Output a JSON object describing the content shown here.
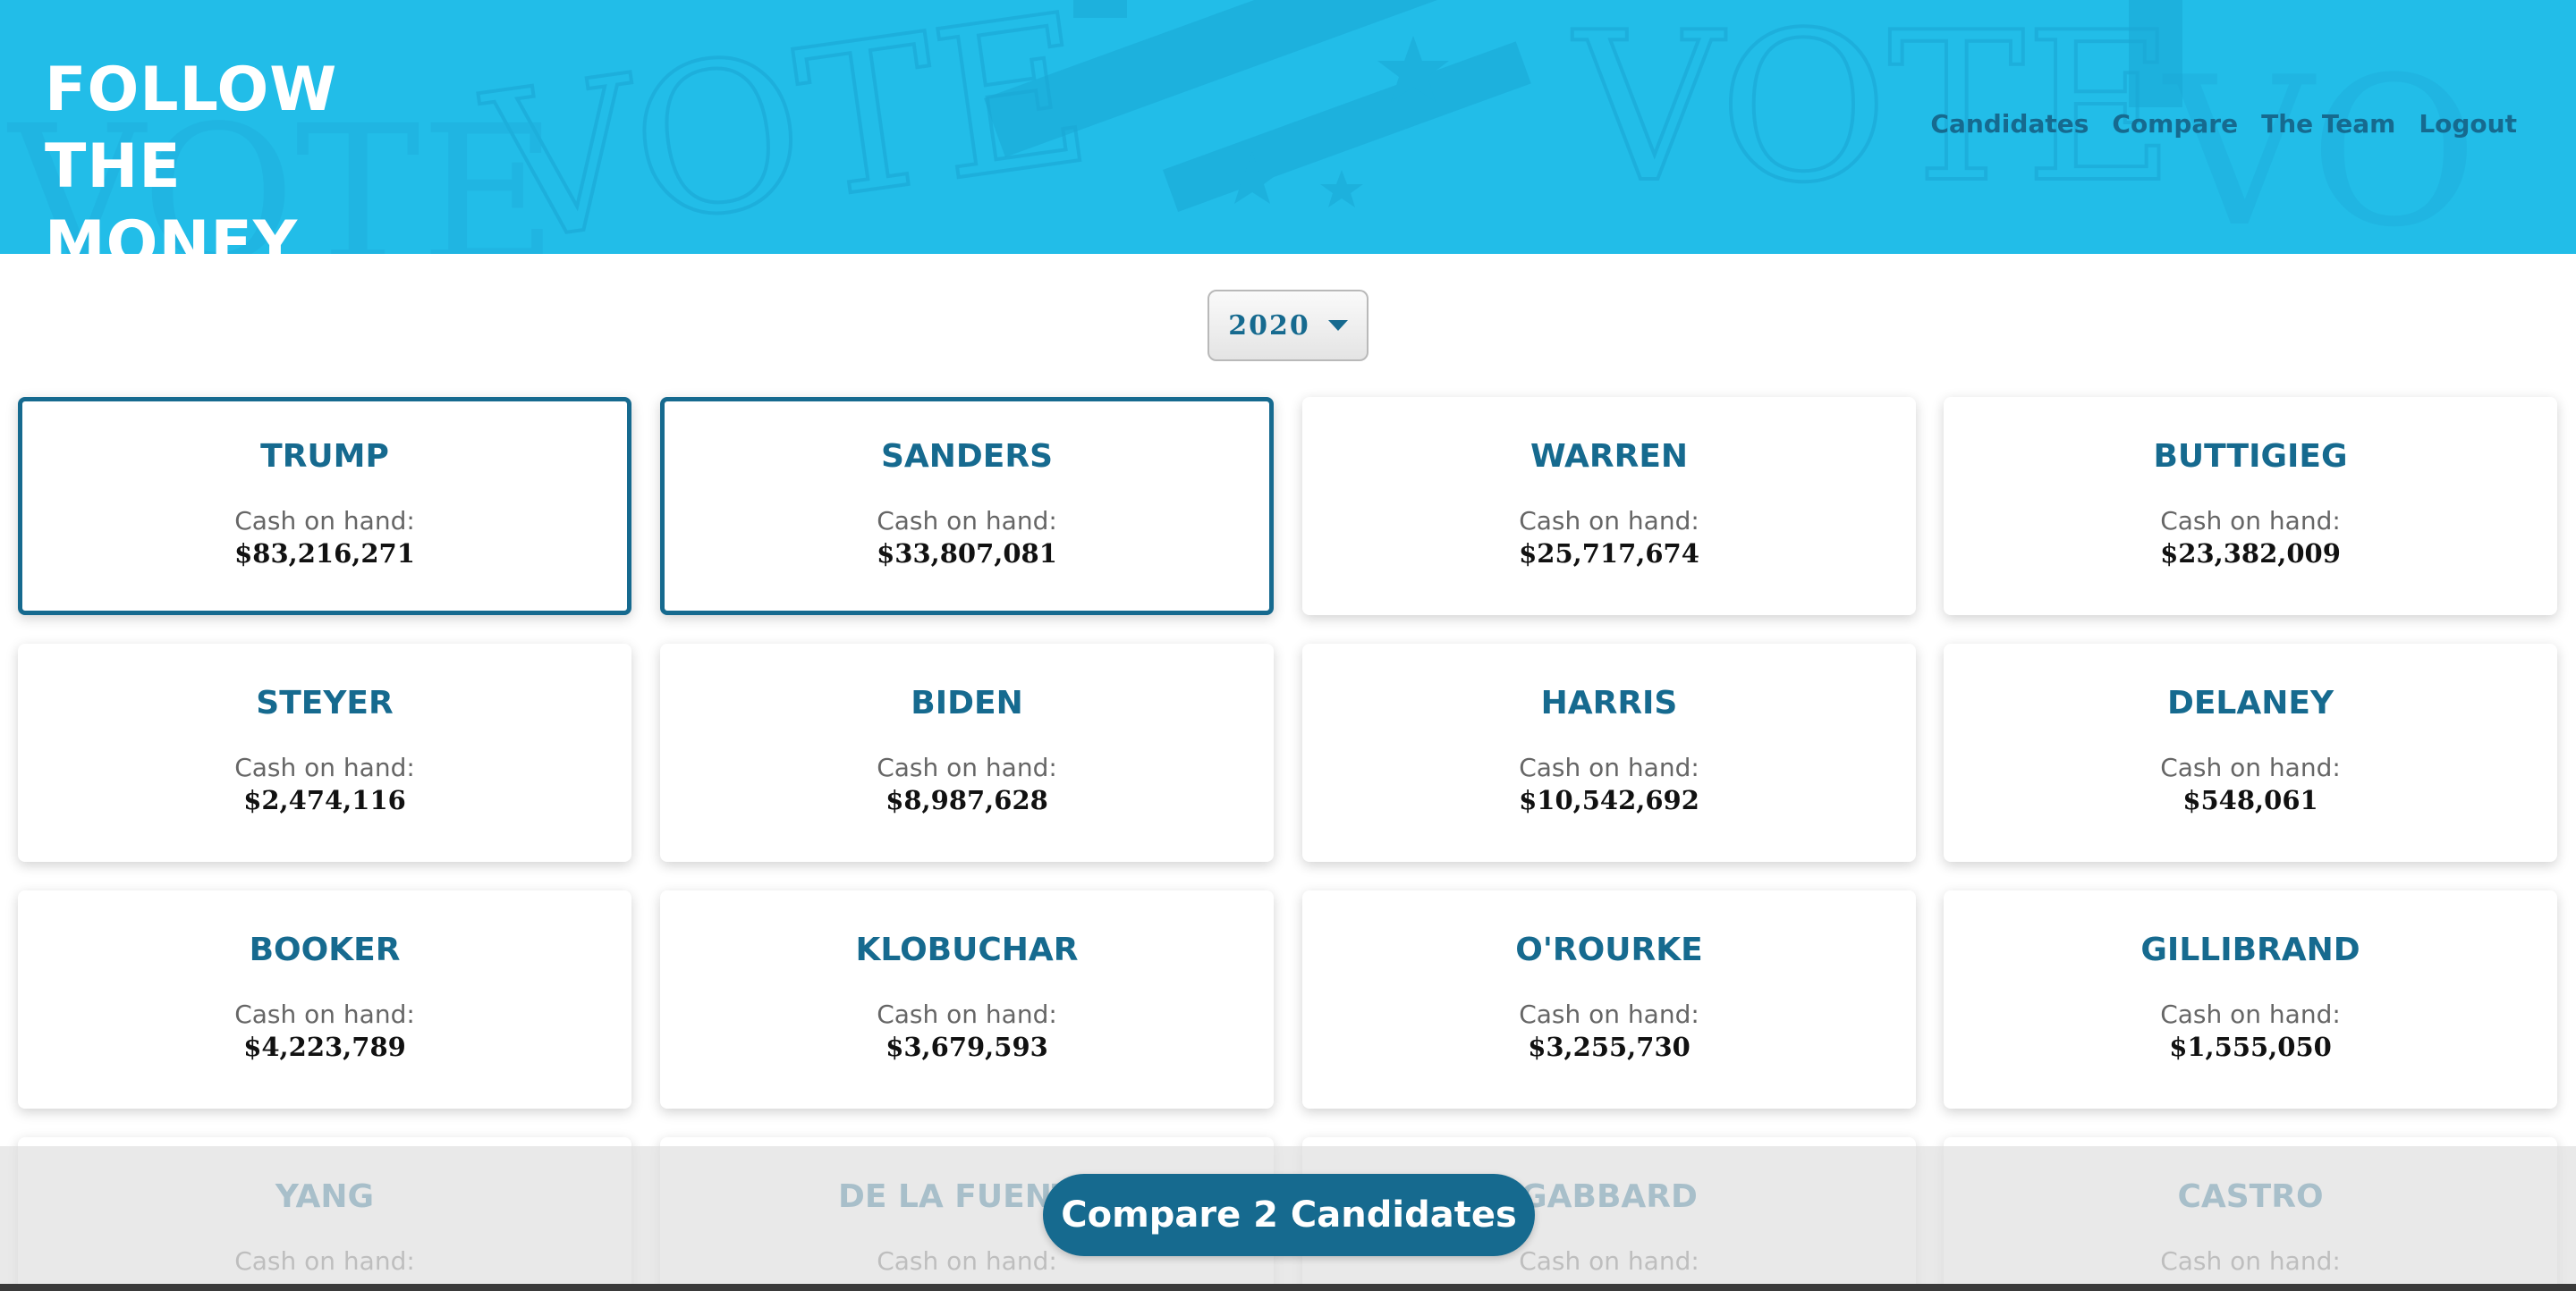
{
  "site": {
    "title_line1": "FOLLOW THE",
    "title_line2": "MONEY"
  },
  "nav": {
    "items": [
      "Candidates",
      "Compare",
      "The Team",
      "Logout"
    ]
  },
  "year_select": {
    "value": "2020"
  },
  "card_label": "Cash on hand:",
  "candidates": [
    {
      "name": "TRUMP",
      "cash": "$83,216,271",
      "selected": true
    },
    {
      "name": "SANDERS",
      "cash": "$33,807,081",
      "selected": true
    },
    {
      "name": "WARREN",
      "cash": "$25,717,674",
      "selected": false
    },
    {
      "name": "BUTTIGIEG",
      "cash": "$23,382,009",
      "selected": false
    },
    {
      "name": "STEYER",
      "cash": "$2,474,116",
      "selected": false
    },
    {
      "name": "BIDEN",
      "cash": "$8,987,628",
      "selected": false
    },
    {
      "name": "HARRIS",
      "cash": "$10,542,692",
      "selected": false
    },
    {
      "name": "DELANEY",
      "cash": "$548,061",
      "selected": false
    },
    {
      "name": "BOOKER",
      "cash": "$4,223,789",
      "selected": false
    },
    {
      "name": "KLOBUCHAR",
      "cash": "$3,679,593",
      "selected": false
    },
    {
      "name": "O'ROURKE",
      "cash": "$3,255,730",
      "selected": false
    },
    {
      "name": "GILLIBRAND",
      "cash": "$1,555,050",
      "selected": false
    },
    {
      "name": "YANG",
      "cash": "",
      "selected": false
    },
    {
      "name": "DE LA FUENTE",
      "cash": "",
      "selected": false
    },
    {
      "name": "GABBARD",
      "cash": "",
      "selected": false
    },
    {
      "name": "CASTRO",
      "cash": "",
      "selected": false
    }
  ],
  "compare_button": {
    "label": "Compare 2 Candidates"
  },
  "colors": {
    "header": "#22bde8",
    "accent": "#166a8f"
  }
}
